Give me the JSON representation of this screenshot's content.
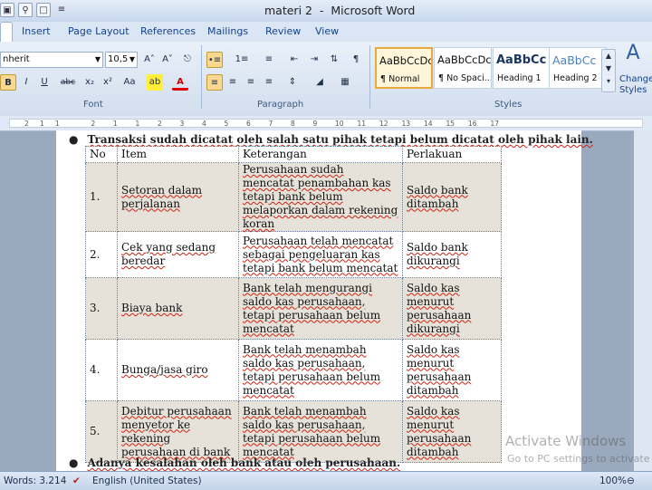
{
  "window": {
    "title": "materi 2  -  Microsoft Word"
  },
  "qat": [
    "save-icon",
    "print-preview-icon",
    "new-doc-icon",
    "customize-icon"
  ],
  "tabs": [
    "Insert",
    "Page Layout",
    "References",
    "Mailings",
    "Review",
    "View"
  ],
  "ribbon": {
    "font_name": "nherit",
    "font_size": "10,5",
    "groups": {
      "font": "Font",
      "paragraph": "Paragraph",
      "styles": "Styles"
    },
    "styles": [
      {
        "sample": "AaBbCcDc",
        "name": "¶ Normal",
        "selected": true
      },
      {
        "sample": "AaBbCcDc",
        "name": "¶ No Spaci...",
        "selected": false
      },
      {
        "sample": "AaBbCc",
        "name": "Heading 1",
        "selected": false
      },
      {
        "sample": "AaBbCc",
        "name": "Heading 2",
        "selected": false
      }
    ],
    "change_styles": "Change Styles"
  },
  "ruler": {
    "ticks": [
      "2",
      "1",
      "1",
      "2",
      "1",
      "1",
      "2",
      "3",
      "4",
      "5",
      "6",
      "7",
      "8",
      "9",
      "10",
      "11",
      "12",
      "13",
      "14",
      "15",
      "16",
      "17"
    ]
  },
  "document": {
    "bullet1": "Transaksi sudah dicatat oleh salah satu pihak tetapi belum dicatat oleh pihak lain.",
    "bullet2": "Adanya kesalahan oleh bank atau oleh perusahaan.",
    "table": {
      "headers": [
        "No",
        "Item",
        "Keterangan",
        "Perlakuan"
      ],
      "rows": [
        {
          "no": "1.",
          "item": "Setoran dalam perjalanan",
          "keterangan": "Perusahaan sudah mencatat penambahan kas tetapi bank belum melaporkan dalam rekening koran",
          "perlakuan": "Saldo bank ditambah"
        },
        {
          "no": "2.",
          "item": "Cek yang sedang beredar",
          "keterangan": "Perusahaan telah mencatat sebagai pengeluaran kas tetapi bank belum mencatat",
          "perlakuan": "Saldo bank dikurangi"
        },
        {
          "no": "3.",
          "item": "Biaya bank",
          "keterangan": "Bank telah mengurangi saldo kas perusahaan, tetapi perusahaan belum mencatat",
          "perlakuan": "Saldo kas menurut perusahaan dikurangi"
        },
        {
          "no": "4.",
          "item": "Bunga/jasa giro",
          "keterangan": "Bank telah menambah saldo kas perusahaan, tetapi perusahaan belum mencatat",
          "perlakuan": "Saldo kas menurut perusahaan ditambah"
        },
        {
          "no": "5.",
          "item": "Debitur perusahaan menyetor ke rekening perusahaan di bank",
          "keterangan": "Bank telah menambah saldo kas perusahaan, tetapi perusahaan belum mencatat",
          "perlakuan": "Saldo kas menurut perusahaan ditambah"
        }
      ]
    }
  },
  "watermark": {
    "line1": "Activate Windows",
    "line2": "Go to PC settings to activate"
  },
  "status": {
    "words": "Words: 3.214",
    "language": "English (United States)",
    "zoom": "100%"
  }
}
